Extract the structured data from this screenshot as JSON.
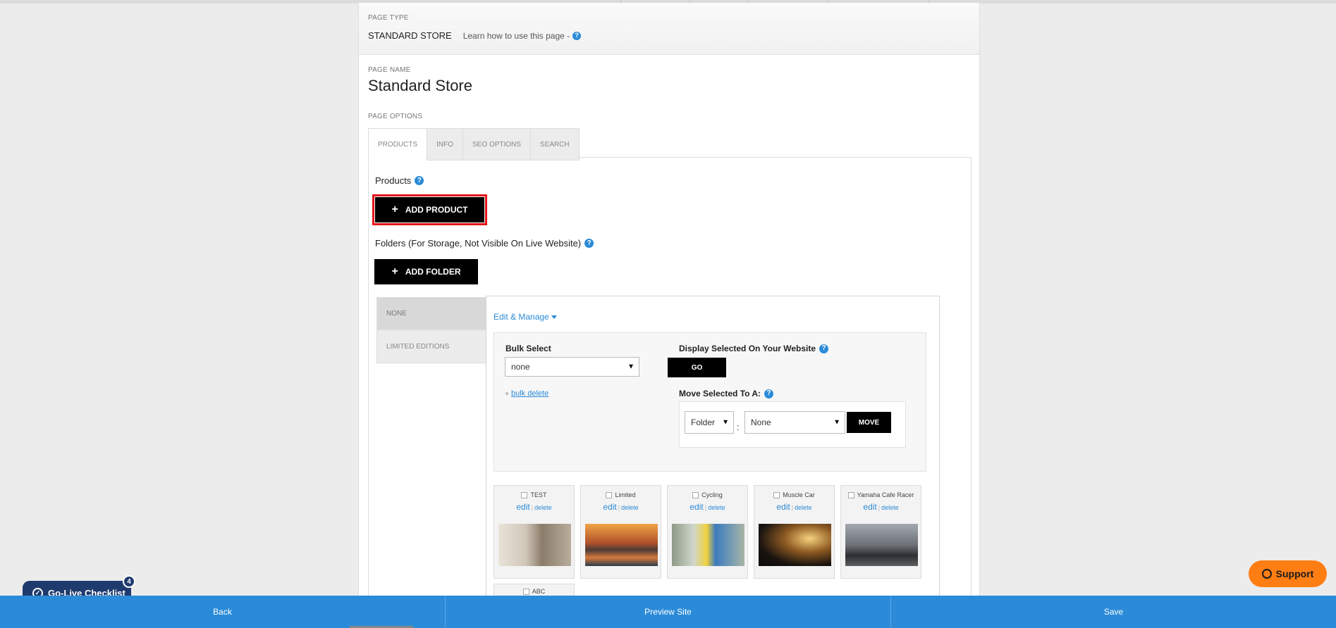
{
  "page_type": {
    "label": "PAGE TYPE",
    "value": "STANDARD STORE",
    "learn_text": "Learn how to use this page -"
  },
  "page_name": {
    "label": "PAGE NAME",
    "value": "Standard Store"
  },
  "page_options": {
    "label": "PAGE OPTIONS"
  },
  "tabs": [
    {
      "label": "PRODUCTS"
    },
    {
      "label": "INFO"
    },
    {
      "label": "SEO OPTIONS"
    },
    {
      "label": "SEARCH"
    }
  ],
  "products": {
    "label": "Products",
    "add_product_label": "ADD PRODUCT",
    "folders_label": "Folders (For Storage, Not Visible On Live Website)",
    "add_folder_label": "ADD FOLDER"
  },
  "folders": [
    {
      "label": "NONE"
    },
    {
      "label": "LIMITED EDITIONS"
    }
  ],
  "manage": {
    "edit_manage_label": "Edit & Manage",
    "bulk_select_label": "Bulk Select",
    "bulk_select_value": "none",
    "bulk_delete_label": "bulk delete",
    "display_selected_label": "Display Selected On Your Website",
    "go_label": "GO",
    "move_selected_label": "Move Selected To A:",
    "move_type_value": "Folder",
    "move_target_value": "None",
    "move_label": "MOVE"
  },
  "product_items": [
    {
      "name": "TEST",
      "edit": "edit",
      "delete": "delete"
    },
    {
      "name": "Limited",
      "edit": "edit",
      "delete": "delete"
    },
    {
      "name": "Cycling",
      "edit": "edit",
      "delete": "delete"
    },
    {
      "name": "Muscle Car",
      "edit": "edit",
      "delete": "delete"
    },
    {
      "name": "Yamaha Cafe Racer",
      "edit": "edit",
      "delete": "delete"
    },
    {
      "name": "ABC"
    }
  ],
  "bottom_bar": {
    "back": "Back",
    "preview": "Preview Site",
    "save": "Save"
  },
  "golive": {
    "label": "Go-Live Checklist",
    "count": "4"
  },
  "support": {
    "label": "Support"
  },
  "colors": {
    "accent": "#2b8bd8",
    "highlight": "#e3151a",
    "support": "#ff7e14",
    "golive": "#1f3b6e"
  }
}
